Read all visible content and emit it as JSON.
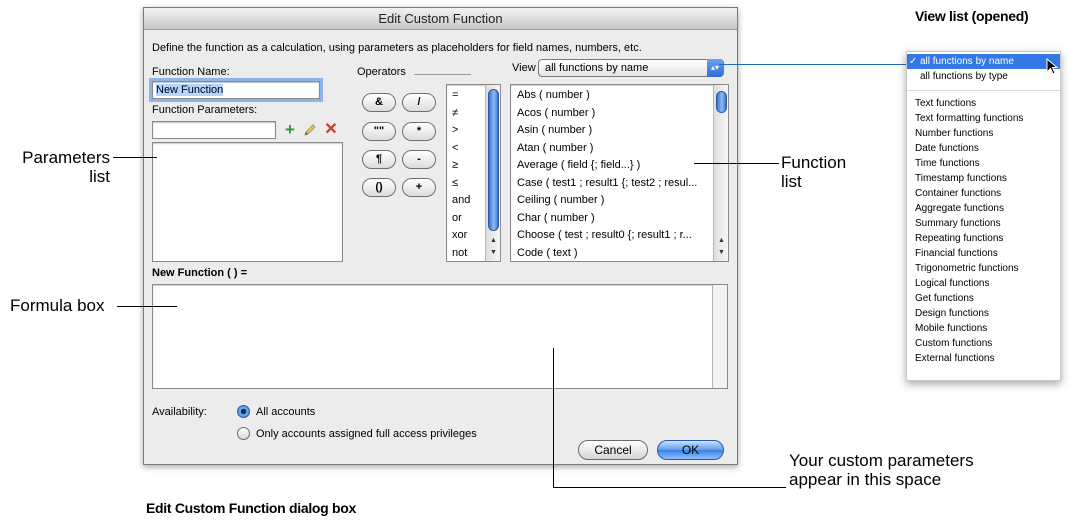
{
  "dialog": {
    "title": "Edit Custom Function",
    "instructions": "Define the function as a calculation, using parameters as placeholders for field names, numbers, etc.",
    "function_name_label": "Function Name:",
    "function_name_value": "New Function",
    "function_parameters_label": "Function Parameters:",
    "operators_label": "Operators",
    "view_label": "View",
    "view_selected": "all functions by name",
    "operator_buttons": [
      "&",
      "/",
      "\"\"",
      "*",
      "¶",
      "-",
      "()",
      "+"
    ],
    "operator_list": [
      "=",
      "≠",
      ">",
      "<",
      "≥",
      "≤",
      "and",
      "or",
      "xor",
      "not"
    ],
    "functions": [
      "Abs ( number )",
      "Acos ( number )",
      "Asin ( number )",
      "Atan ( number )",
      "Average ( field {; field...} )",
      "Case ( test1 ; result1 {; test2 ; resul...",
      "Ceiling ( number )",
      "Char ( number )",
      "Choose ( test ; result0 {; result1 ; r...",
      "Code ( text )"
    ],
    "formula_label": "New Function ( ) =",
    "availability_label": "Availability:",
    "availability_all": "All accounts",
    "availability_full": "Only accounts assigned full access privileges",
    "cancel_label": "Cancel",
    "ok_label": "OK"
  },
  "callouts": {
    "parameters_list": [
      "Parameters",
      "list"
    ],
    "formula_box": "Formula box",
    "function_list": [
      "Function",
      "list"
    ],
    "custom_params": [
      "Your custom parameters",
      "appear in this space"
    ]
  },
  "headings": {
    "view_list": "View list (opened)",
    "dialog_caption": "Edit Custom Function dialog box"
  },
  "view_menu": {
    "checked": "✓",
    "top_items": [
      "all functions by name",
      "all functions by type"
    ],
    "items": [
      "Text functions",
      "Text formatting functions",
      "Number functions",
      "Date functions",
      "Time functions",
      "Timestamp functions",
      "Container functions",
      "Aggregate functions",
      "Summary functions",
      "Repeating functions",
      "Financial functions",
      "Trigonometric functions",
      "Logical functions",
      "Get functions",
      "Design functions",
      "Mobile functions",
      "Custom functions",
      "External functions"
    ]
  },
  "colors": {
    "accent": "#3478e5",
    "add": "#2e9d2e",
    "delete": "#d0362b",
    "callout_line": "#1b6cb5"
  },
  "icons": {
    "add": "plus-icon",
    "edit": "pencil-icon",
    "delete": "x-icon",
    "cursor": "mouse-pointer-icon"
  }
}
